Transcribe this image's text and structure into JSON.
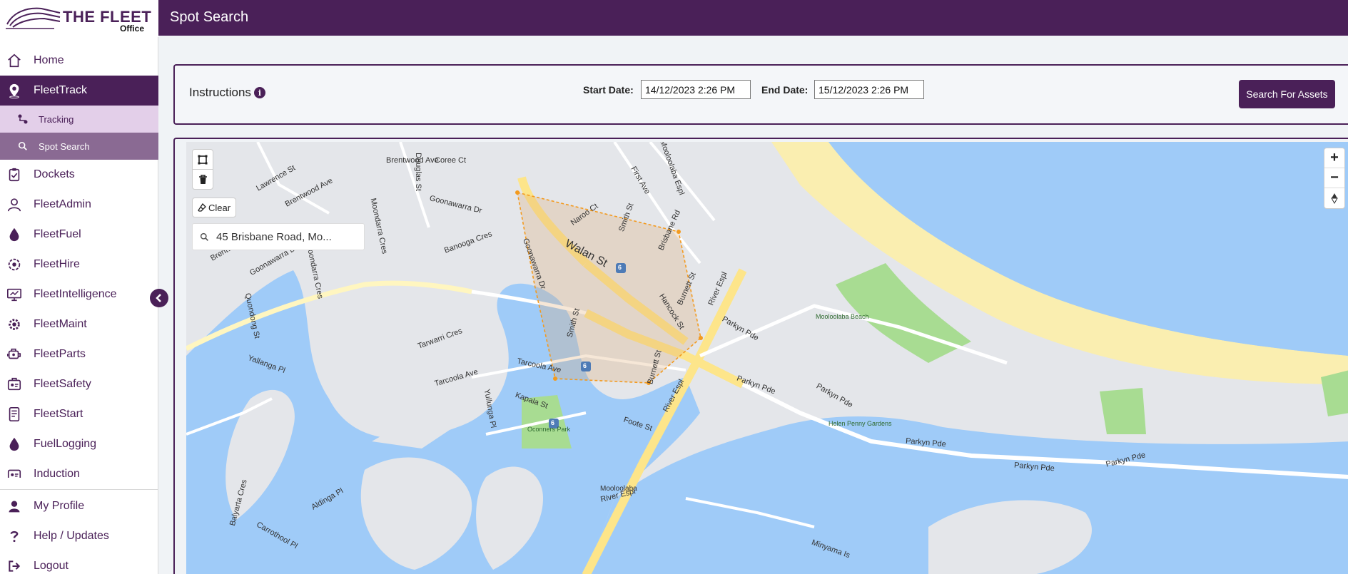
{
  "brand": {
    "name": "THE FLEET",
    "sub": "Office"
  },
  "header": {
    "title": "Spot Search"
  },
  "sidebar": {
    "items": [
      {
        "label": "Home",
        "icon": "home-icon"
      },
      {
        "label": "FleetTrack",
        "icon": "location-pin-icon"
      },
      {
        "label": "Dockets",
        "icon": "clipboard-icon"
      },
      {
        "label": "FleetAdmin",
        "icon": "user-icon"
      },
      {
        "label": "FleetFuel",
        "icon": "fuel-drop-icon"
      },
      {
        "label": "FleetHire",
        "icon": "hire-icon"
      },
      {
        "label": "FleetIntelligence",
        "icon": "monitor-chart-icon"
      },
      {
        "label": "FleetMaint",
        "icon": "gear-icon"
      },
      {
        "label": "FleetParts",
        "icon": "engine-icon"
      },
      {
        "label": "FleetSafety",
        "icon": "safety-icon"
      },
      {
        "label": "FleetStart",
        "icon": "checklist-icon"
      },
      {
        "label": "FuelLogging",
        "icon": "fuel-drop-icon"
      },
      {
        "label": "Induction",
        "icon": "induction-icon"
      }
    ],
    "subitems": [
      {
        "label": "Tracking",
        "icon": "map-route-icon"
      },
      {
        "label": "Spot Search",
        "icon": "search-icon"
      }
    ],
    "bottom": [
      {
        "label": "My Profile",
        "icon": "profile-icon"
      },
      {
        "label": "Help / Updates",
        "icon": "question-icon"
      },
      {
        "label": "Logout",
        "icon": "logout-icon"
      }
    ]
  },
  "filter": {
    "instructions": "Instructions",
    "info_glyph": "i",
    "start_label": "Start Date:",
    "start_value": "14/12/2023 2:26 PM",
    "end_label": "End Date:",
    "end_value": "15/12/2023 2:26 PM",
    "search_button": "Search For Assets"
  },
  "map": {
    "clear_label": "Clear",
    "address_value": "45 Brisbane Road, Mo...",
    "zoom_in": "+",
    "zoom_out": "−",
    "labels": {
      "walan": "Walan St",
      "goonawarra": "Goonawarra Dr",
      "goonawarra2": "Goonawarra Dr",
      "goonawarra3": "Goonawarra Dr",
      "brentwood": "Brentwood Ave",
      "brentwood2": "Brentwood Ave",
      "brentwood3": "Brentwood Ave",
      "lawrence": "Lawrence St",
      "douglas": "Douglas St",
      "coree": "Coree Ct",
      "moondarra": "Moondarra Cres",
      "moondarra2": "Moondarra Cres",
      "quondong": "Quondong St",
      "yallanga": "Yallanga Pl",
      "tarwarri": "Tarwarri Cres",
      "tarcoola": "Tarcoola Ave",
      "tarcoola2": "Tarcoola Ave",
      "kapala": "Kapala St",
      "yullunga": "Yullunga Pl",
      "oconners": "Oconners Park",
      "smith": "Smith St",
      "smith2": "Smith St",
      "naroo": "Naroo Ct",
      "first": "First Ave",
      "brisbane": "Brisbane Rd",
      "burnett": "Burnett St",
      "burnett2": "Burnett St",
      "hancock": "Hancock St",
      "foote": "Foote St",
      "riverespl": "River Espl",
      "riverespl2": "River Espl",
      "riverespl3": "River Espl",
      "parkyn": "Parkyn Pde",
      "parkyn2": "Parkyn Pde",
      "parkyn3": "Parkyn Pde",
      "parkyn4": "Parkyn Pde",
      "parkyn5": "Parkyn Pde",
      "parkyn6": "Parkyn Pde",
      "mooloolababeach": "Mooloolaba Beach",
      "helenpenny": "Helen Penny Gardens",
      "mooloolaba": "Mooloolaba",
      "carrothool": "Carrothool Pl",
      "aldinga": "Aldinga Pl",
      "balyarta": "Balyarta Cres",
      "minyama": "Minyama Is",
      "mooloolahespl": "Mooloolaba Espl",
      "bunyooga": "Banooga Cres",
      "shield": "6"
    }
  }
}
